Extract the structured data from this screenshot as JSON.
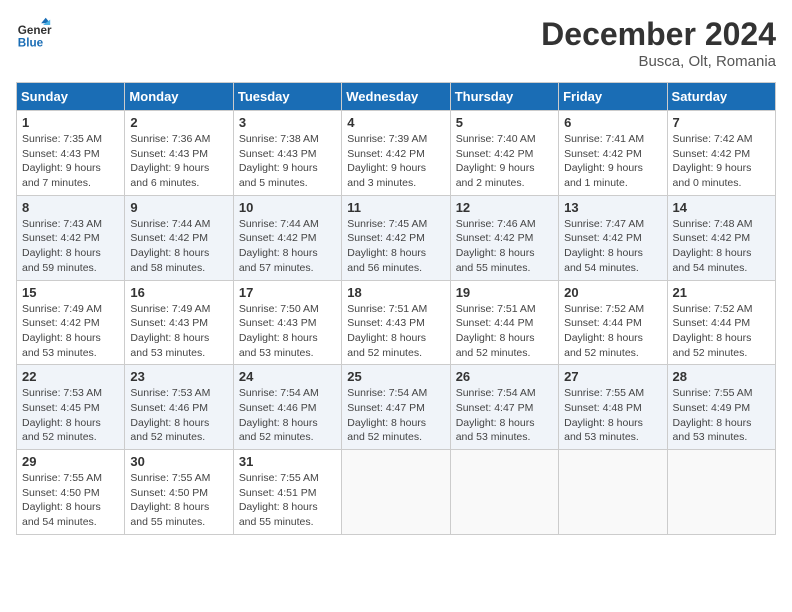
{
  "logo": {
    "line1": "General",
    "line2": "Blue"
  },
  "title": "December 2024",
  "location": "Busca, Olt, Romania",
  "weekdays": [
    "Sunday",
    "Monday",
    "Tuesday",
    "Wednesday",
    "Thursday",
    "Friday",
    "Saturday"
  ],
  "weeks": [
    [
      {
        "day": "1",
        "info": "Sunrise: 7:35 AM\nSunset: 4:43 PM\nDaylight: 9 hours and 7 minutes."
      },
      {
        "day": "2",
        "info": "Sunrise: 7:36 AM\nSunset: 4:43 PM\nDaylight: 9 hours and 6 minutes."
      },
      {
        "day": "3",
        "info": "Sunrise: 7:38 AM\nSunset: 4:43 PM\nDaylight: 9 hours and 5 minutes."
      },
      {
        "day": "4",
        "info": "Sunrise: 7:39 AM\nSunset: 4:42 PM\nDaylight: 9 hours and 3 minutes."
      },
      {
        "day": "5",
        "info": "Sunrise: 7:40 AM\nSunset: 4:42 PM\nDaylight: 9 hours and 2 minutes."
      },
      {
        "day": "6",
        "info": "Sunrise: 7:41 AM\nSunset: 4:42 PM\nDaylight: 9 hours and 1 minute."
      },
      {
        "day": "7",
        "info": "Sunrise: 7:42 AM\nSunset: 4:42 PM\nDaylight: 9 hours and 0 minutes."
      }
    ],
    [
      {
        "day": "8",
        "info": "Sunrise: 7:43 AM\nSunset: 4:42 PM\nDaylight: 8 hours and 59 minutes."
      },
      {
        "day": "9",
        "info": "Sunrise: 7:44 AM\nSunset: 4:42 PM\nDaylight: 8 hours and 58 minutes."
      },
      {
        "day": "10",
        "info": "Sunrise: 7:44 AM\nSunset: 4:42 PM\nDaylight: 8 hours and 57 minutes."
      },
      {
        "day": "11",
        "info": "Sunrise: 7:45 AM\nSunset: 4:42 PM\nDaylight: 8 hours and 56 minutes."
      },
      {
        "day": "12",
        "info": "Sunrise: 7:46 AM\nSunset: 4:42 PM\nDaylight: 8 hours and 55 minutes."
      },
      {
        "day": "13",
        "info": "Sunrise: 7:47 AM\nSunset: 4:42 PM\nDaylight: 8 hours and 54 minutes."
      },
      {
        "day": "14",
        "info": "Sunrise: 7:48 AM\nSunset: 4:42 PM\nDaylight: 8 hours and 54 minutes."
      }
    ],
    [
      {
        "day": "15",
        "info": "Sunrise: 7:49 AM\nSunset: 4:42 PM\nDaylight: 8 hours and 53 minutes."
      },
      {
        "day": "16",
        "info": "Sunrise: 7:49 AM\nSunset: 4:43 PM\nDaylight: 8 hours and 53 minutes."
      },
      {
        "day": "17",
        "info": "Sunrise: 7:50 AM\nSunset: 4:43 PM\nDaylight: 8 hours and 53 minutes."
      },
      {
        "day": "18",
        "info": "Sunrise: 7:51 AM\nSunset: 4:43 PM\nDaylight: 8 hours and 52 minutes."
      },
      {
        "day": "19",
        "info": "Sunrise: 7:51 AM\nSunset: 4:44 PM\nDaylight: 8 hours and 52 minutes."
      },
      {
        "day": "20",
        "info": "Sunrise: 7:52 AM\nSunset: 4:44 PM\nDaylight: 8 hours and 52 minutes."
      },
      {
        "day": "21",
        "info": "Sunrise: 7:52 AM\nSunset: 4:44 PM\nDaylight: 8 hours and 52 minutes."
      }
    ],
    [
      {
        "day": "22",
        "info": "Sunrise: 7:53 AM\nSunset: 4:45 PM\nDaylight: 8 hours and 52 minutes."
      },
      {
        "day": "23",
        "info": "Sunrise: 7:53 AM\nSunset: 4:46 PM\nDaylight: 8 hours and 52 minutes."
      },
      {
        "day": "24",
        "info": "Sunrise: 7:54 AM\nSunset: 4:46 PM\nDaylight: 8 hours and 52 minutes."
      },
      {
        "day": "25",
        "info": "Sunrise: 7:54 AM\nSunset: 4:47 PM\nDaylight: 8 hours and 52 minutes."
      },
      {
        "day": "26",
        "info": "Sunrise: 7:54 AM\nSunset: 4:47 PM\nDaylight: 8 hours and 53 minutes."
      },
      {
        "day": "27",
        "info": "Sunrise: 7:55 AM\nSunset: 4:48 PM\nDaylight: 8 hours and 53 minutes."
      },
      {
        "day": "28",
        "info": "Sunrise: 7:55 AM\nSunset: 4:49 PM\nDaylight: 8 hours and 53 minutes."
      }
    ],
    [
      {
        "day": "29",
        "info": "Sunrise: 7:55 AM\nSunset: 4:50 PM\nDaylight: 8 hours and 54 minutes."
      },
      {
        "day": "30",
        "info": "Sunrise: 7:55 AM\nSunset: 4:50 PM\nDaylight: 8 hours and 55 minutes."
      },
      {
        "day": "31",
        "info": "Sunrise: 7:55 AM\nSunset: 4:51 PM\nDaylight: 8 hours and 55 minutes."
      },
      null,
      null,
      null,
      null
    ]
  ]
}
